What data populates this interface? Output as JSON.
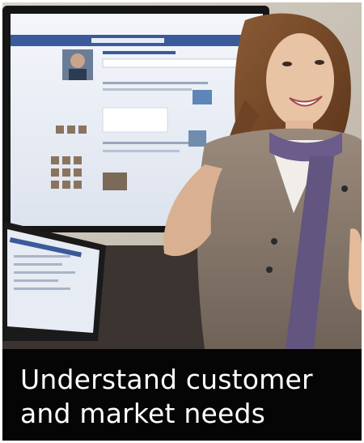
{
  "tile": {
    "caption_line_1": "Understand customer",
    "caption_line_2": "and market needs"
  },
  "photo": {
    "subject": "woman presenting in front of a monitor and a laptop showing a social network profile page"
  }
}
